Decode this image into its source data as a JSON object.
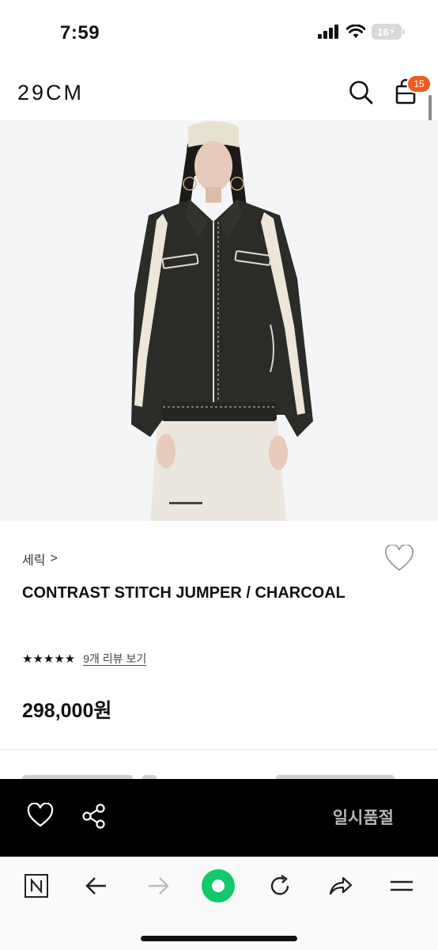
{
  "status": {
    "time": "7:59",
    "battery": "16"
  },
  "header": {
    "logo": "29CM",
    "cart_count": "15"
  },
  "product": {
    "brand": "세릭",
    "brand_chevron": ">",
    "title": "CONTRAST STITCH JUMPER / CHARCOAL",
    "stars": "★★★★★",
    "rating": 5,
    "review_link": "9개 리뷰 보기",
    "price": "298,000원"
  },
  "action_bar": {
    "sold_out_label": "일시품절"
  },
  "colors": {
    "accent": "#f15a24",
    "jacket": "#2b2b27",
    "stripe": "#ece7d8",
    "action_bar": "#000000"
  },
  "icons": [
    "signal-icon",
    "wifi-icon",
    "battery-icon",
    "search-icon",
    "cart-icon",
    "heart-icon",
    "share-icon",
    "naver-icon",
    "back-arrow-icon",
    "forward-arrow-icon",
    "green-circle-icon",
    "refresh-icon",
    "share-arrow-icon",
    "menu-icon"
  ]
}
